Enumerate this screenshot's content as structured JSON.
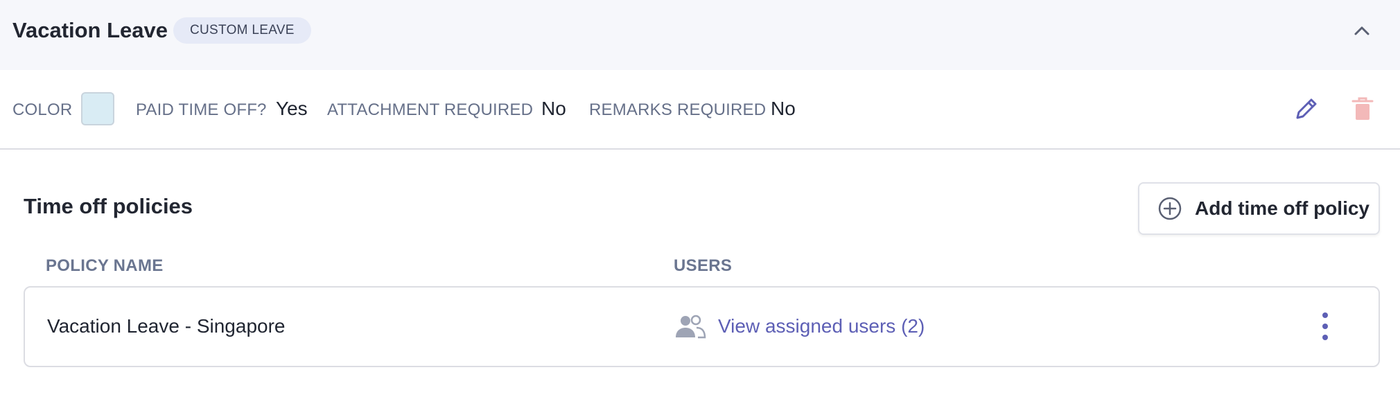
{
  "leave_type": {
    "title": "Vacation Leave",
    "badge": "CUSTOM LEAVE",
    "collapse_icon": "chevron-up-icon"
  },
  "details": {
    "color_label": "COLOR",
    "color_value": "#d9ecf4",
    "paid_label": "PAID TIME OFF?",
    "paid_value": "Yes",
    "attachment_label": "ATTACHMENT REQUIRED",
    "attachment_value": "No",
    "remarks_label": "REMARKS REQUIRED",
    "remarks_value": "No",
    "edit_icon": "pencil-icon",
    "delete_icon": "trash-icon"
  },
  "policies": {
    "title": "Time off policies",
    "add_button": "Add time off policy",
    "columns": [
      "POLICY NAME",
      "USERS"
    ],
    "rows": [
      {
        "name": "Vacation Leave - Singapore",
        "users_link": "View assigned users (2)"
      }
    ]
  },
  "colors": {
    "accent": "#5d5fb5",
    "header_bg": "#f6f7fb",
    "delete_disabled": "#f3b9b9"
  }
}
